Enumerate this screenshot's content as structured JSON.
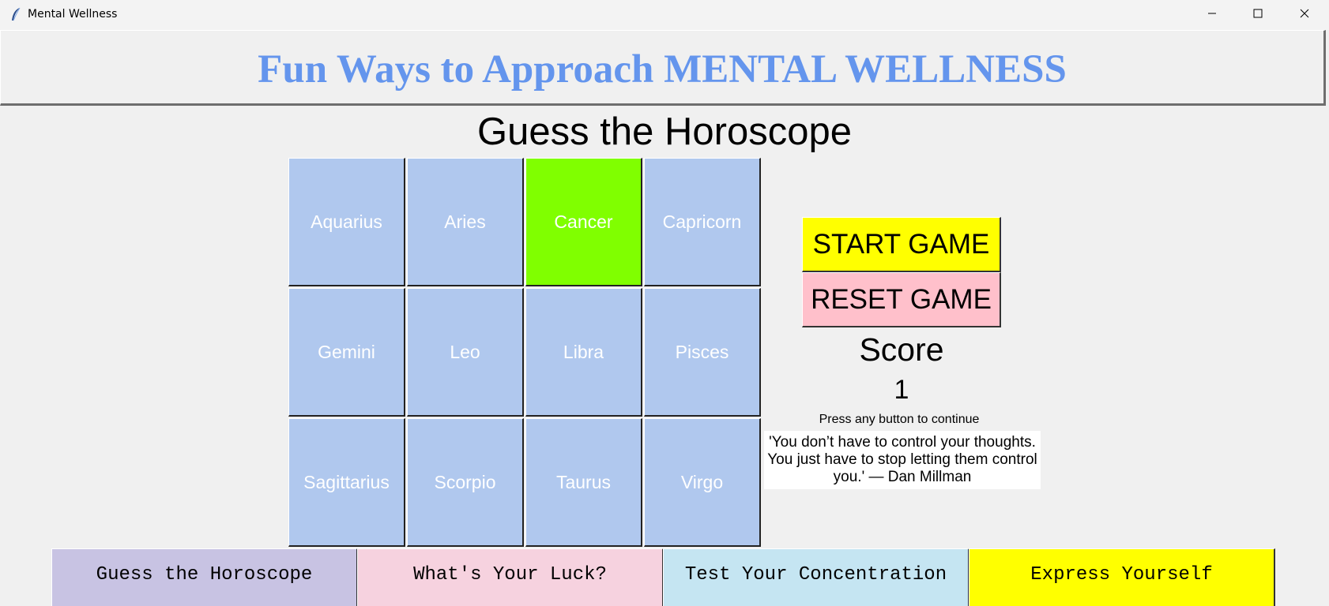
{
  "window": {
    "title": "Mental Wellness"
  },
  "header": {
    "banner": "Fun Ways to Approach MENTAL WELLNESS"
  },
  "game": {
    "title": "Guess the Horoscope",
    "signs": [
      {
        "label": "Aquarius",
        "selected": false
      },
      {
        "label": "Aries",
        "selected": false
      },
      {
        "label": "Cancer",
        "selected": true
      },
      {
        "label": "Capricorn",
        "selected": false
      },
      {
        "label": "Gemini",
        "selected": false
      },
      {
        "label": "Leo",
        "selected": false
      },
      {
        "label": "Libra",
        "selected": false
      },
      {
        "label": "Pisces",
        "selected": false
      },
      {
        "label": "Sagittarius",
        "selected": false
      },
      {
        "label": "Scorpio",
        "selected": false
      },
      {
        "label": "Taurus",
        "selected": false
      },
      {
        "label": "Virgo",
        "selected": false
      }
    ],
    "start_label": "START GAME",
    "reset_label": "RESET GAME",
    "score_label": "Score",
    "score_value": "1",
    "hint": "Press any button to continue",
    "quote": "'You don’t have to control your thoughts. You just have to stop letting them control you.' — Dan Millman"
  },
  "tabs": [
    {
      "label": "Guess the Horoscope"
    },
    {
      "label": "What's Your Luck?"
    },
    {
      "label": "Test Your Concentration"
    },
    {
      "label": "Express Yourself"
    }
  ],
  "colors": {
    "banner_text": "#6495ed",
    "cell": "#b0c8ee",
    "cell_selected": "#80ff00",
    "start": "#ffff00",
    "reset": "#ffc0cb"
  },
  "icons": {
    "app": "feather-icon",
    "minimize": "minimize-icon",
    "maximize": "maximize-icon",
    "close": "close-icon"
  }
}
